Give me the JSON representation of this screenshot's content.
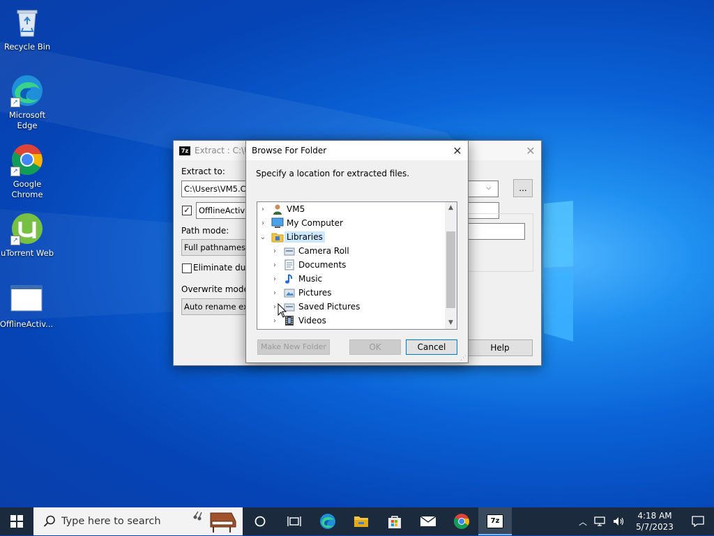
{
  "desktop": {
    "icons": [
      {
        "label": "Recycle Bin",
        "icon": "recycle-bin-icon"
      },
      {
        "label": "Microsoft Edge",
        "icon": "edge-icon"
      },
      {
        "label": "Google Chrome",
        "icon": "chrome-icon"
      },
      {
        "label": "uTorrent Web",
        "icon": "utorrent-icon"
      },
      {
        "label": "OfflineActiv...",
        "icon": "blank-file-icon"
      }
    ]
  },
  "extract_dialog": {
    "title": "Extract : C:\\Use",
    "extract_to_label": "Extract to:",
    "extract_to_value": "C:\\Users\\VM5.COI",
    "browse_button": "...",
    "subfolder_value": "OfflineActivatio",
    "subfolder_checked": true,
    "path_mode_label": "Path mode:",
    "path_mode_value": "Full pathnames",
    "eliminate_label": "Eliminate duplica",
    "overwrite_label": "Overwrite mode:",
    "overwrite_value": "Auto rename existin",
    "help_button": "Help"
  },
  "browse_dialog": {
    "title": "Browse For Folder",
    "instruction": "Specify a location for extracted files.",
    "tree": [
      {
        "label": "VM5",
        "icon": "user-icon",
        "level": 0,
        "expanded": false,
        "selected": false
      },
      {
        "label": "My Computer",
        "icon": "computer-icon",
        "level": 0,
        "expanded": false,
        "selected": false
      },
      {
        "label": "Libraries",
        "icon": "libraries-folder-icon",
        "level": 0,
        "expanded": true,
        "selected": true
      },
      {
        "label": "Camera Roll",
        "icon": "library-icon",
        "level": 1,
        "expanded": false,
        "selected": false
      },
      {
        "label": "Documents",
        "icon": "documents-icon",
        "level": 1,
        "expanded": false,
        "selected": false
      },
      {
        "label": "Music",
        "icon": "music-icon",
        "level": 1,
        "expanded": false,
        "selected": false
      },
      {
        "label": "Pictures",
        "icon": "pictures-icon",
        "level": 1,
        "expanded": false,
        "selected": false
      },
      {
        "label": "Saved Pictures",
        "icon": "library-icon",
        "level": 1,
        "expanded": false,
        "selected": false
      },
      {
        "label": "Videos",
        "icon": "videos-icon",
        "level": 1,
        "expanded": false,
        "selected": false
      }
    ],
    "make_new_folder_button": "Make New Folder",
    "ok_button": "OK",
    "cancel_button": "Cancel"
  },
  "taskbar": {
    "search_placeholder": "Type here to search",
    "apps": [
      "task-view-icon",
      "edge-icon",
      "file-explorer-icon",
      "store-icon",
      "mail-icon",
      "chrome-icon",
      "7zip-icon"
    ],
    "clock_time": "4:18 AM",
    "clock_date": "5/7/2023"
  },
  "colors": {
    "desktop_blue": "#0a63d6",
    "selection": "#cce8ff",
    "taskbar": "#1b2a3c",
    "accent": "#0078d7"
  }
}
